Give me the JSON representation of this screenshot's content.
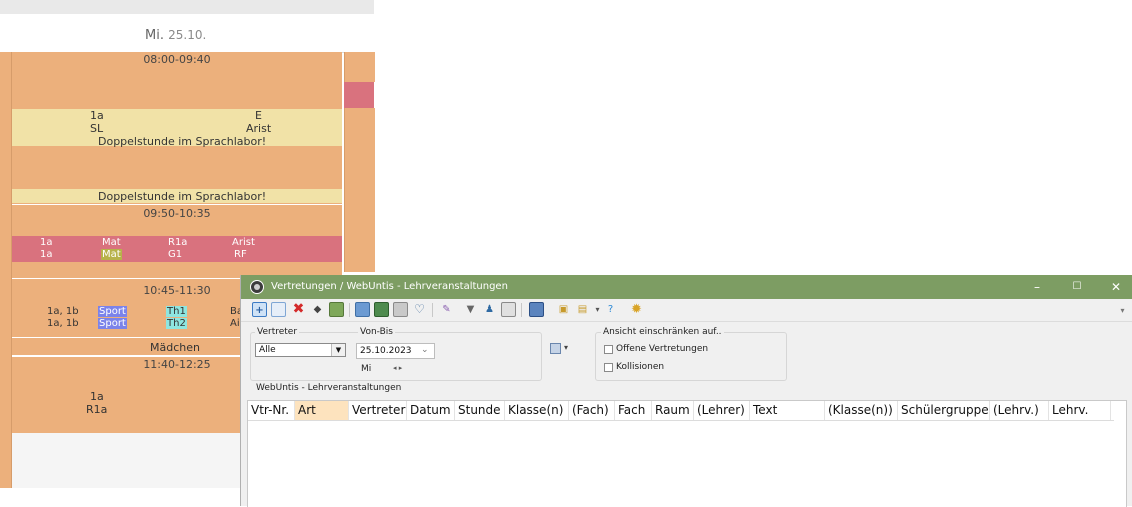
{
  "timetable": {
    "day_name": "Mi.",
    "day_date": "25.10.",
    "slot1_time": "08:00-09:40",
    "slot1_class": "1a",
    "slot1_subject_code": "E",
    "slot1_room": "SL",
    "slot1_teacher": "Arist",
    "slot1_note": "Doppelstunde im Sprachlabor!",
    "slot1_note2": "Doppelstunde im Sprachlabor!",
    "slot2_time": "09:50-10:35",
    "slot2_row1": {
      "class": "1a",
      "subject": "Mat",
      "room": "R1a",
      "teacher": "Arist"
    },
    "slot2_row2": {
      "class": "1a",
      "subject": "Mat",
      "room": "G1",
      "teacher": "RF"
    },
    "slot3_time": "10:45-11:30",
    "slot3_row1": {
      "class": "1a, 1b",
      "subject": "Sport",
      "group": "Th1",
      "extra": "Ba"
    },
    "slot3_row2": {
      "class": "1a, 1b",
      "subject": "Sport",
      "group": "Th2",
      "extra": "Ai"
    },
    "slot3_note": "Mädchen",
    "slot4_time": "11:40-12:25",
    "slot4_class": "1a",
    "slot4_room": "R1a"
  },
  "window": {
    "title": "Vertretungen / WebUntis - Lehrveranstaltungen",
    "controls": {
      "minimize": "–",
      "maximize": "☐",
      "close": "✕"
    },
    "filters": {
      "vertreter_label": "Vertreter",
      "vertreter_value": "Alle",
      "vonbis_label": "Von-Bis",
      "date_value": "25.10.2023",
      "weekday_value": "Mi",
      "ansicht_label": "Ansicht einschränken auf..",
      "opt_offene": "Offene Vertretungen",
      "opt_kollisionen": "Kollisionen"
    },
    "section_label": "WebUntis - Lehrveranstaltungen",
    "columns": [
      "Vtr-Nr.",
      "Art",
      "Vertreter",
      "Datum",
      "Stunde",
      "Klasse(n)",
      "(Fach)",
      "Fach",
      "Raum",
      "(Lehrer)",
      "Text",
      "(Klasse(n))",
      "Schülergruppe",
      "(Lehrv.)",
      "Lehrv."
    ]
  },
  "colors": {
    "titlebar": "#7d9d63",
    "lesson_orange": "#ecb07c",
    "lesson_yellow": "#f1e2a7",
    "lesson_red": "#d9727e",
    "sport_chip": "#7b83ea",
    "group_chip": "#8ee6e0",
    "mat_chip": "#b7b24a",
    "selected_header": "#fde3be"
  }
}
